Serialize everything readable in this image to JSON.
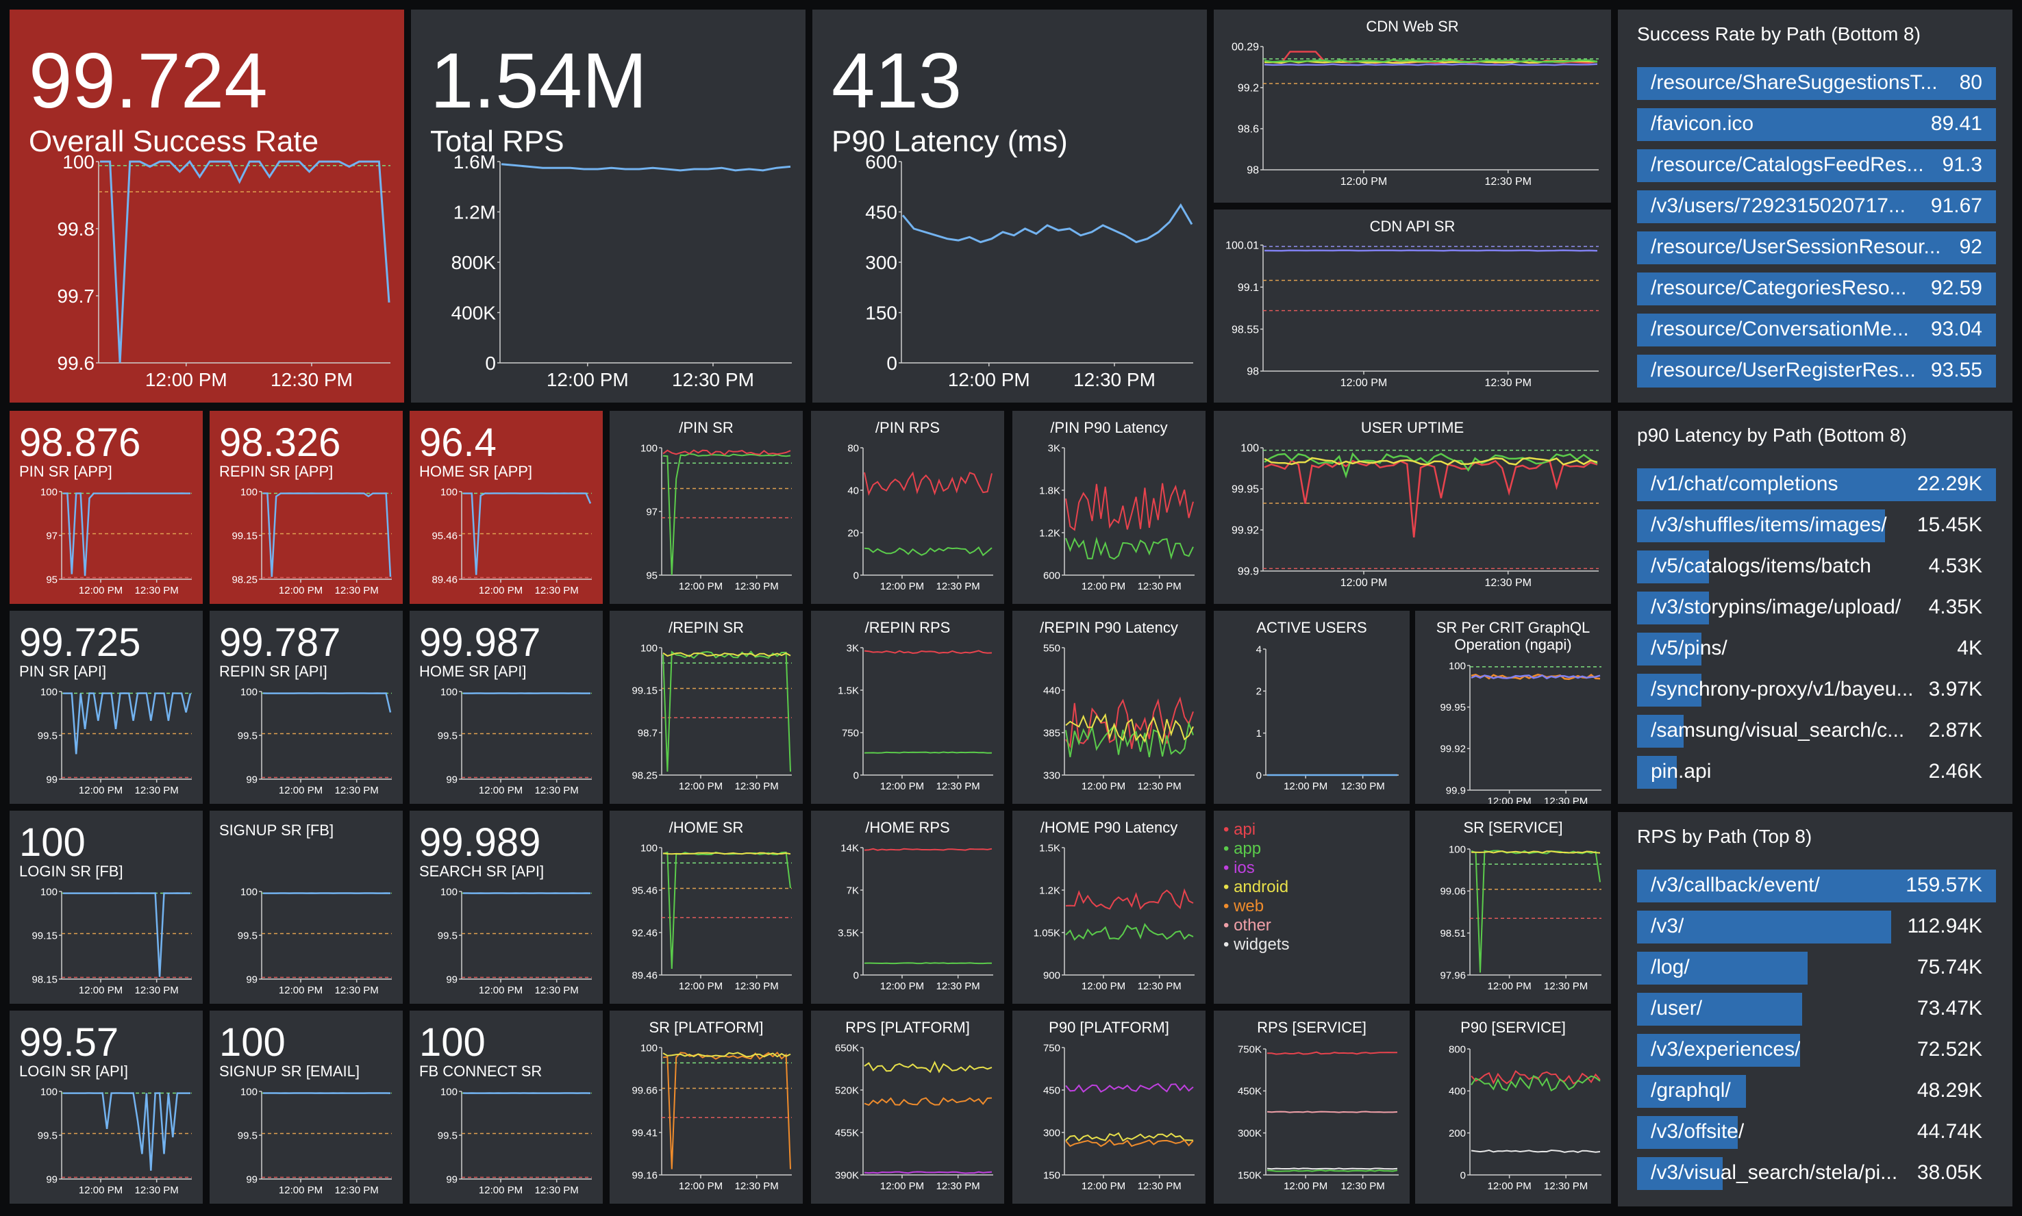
{
  "top_panels": [
    {
      "value": "99.724",
      "label": "Overall Success Rate"
    },
    {
      "value": "1.54M",
      "label": "Total RPS"
    },
    {
      "value": "413",
      "label": "P90 Latency (ms)"
    }
  ],
  "small_stats": [
    {
      "value": "98.876",
      "label": "PIN SR [APP]"
    },
    {
      "value": "98.326",
      "label": "REPIN SR [APP]"
    },
    {
      "value": "96.4",
      "label": "HOME SR [APP]"
    },
    {
      "value": "99.725",
      "label": "PIN SR [API]"
    },
    {
      "value": "99.787",
      "label": "REPIN SR [API]"
    },
    {
      "value": "99.987",
      "label": "HOME SR [API]"
    },
    {
      "value": "100",
      "label": "LOGIN SR [FB]"
    },
    {
      "value": "",
      "label": "SIGNUP SR [FB]"
    },
    {
      "value": "99.989",
      "label": "SEARCH SR [API]"
    },
    {
      "value": "99.57",
      "label": "LOGIN SR [API]"
    },
    {
      "value": "100",
      "label": "SIGNUP SR [EMAIL]"
    },
    {
      "value": "100",
      "label": "FB CONNECT SR"
    }
  ],
  "titled_charts": [
    "CDN Web SR",
    "CDN API SR",
    "/PIN SR",
    "/PIN RPS",
    "/PIN P90 Latency",
    "USER UPTIME",
    "/REPIN SR",
    "/REPIN RPS",
    "/REPIN P90 Latency",
    "ACTIVE USERS",
    "SR Per CRIT GraphQL Operation (ngapi)",
    "/HOME SR",
    "/HOME RPS",
    "/HOME P90 Latency",
    "SR [SERVICE]",
    "SR [PLATFORM]",
    "RPS [PLATFORM]",
    "P90 [PLATFORM]",
    "RPS [SERVICE]",
    "P90 [SERVICE]"
  ],
  "legend": [
    {
      "name": "api",
      "color": "#e8434d"
    },
    {
      "name": "app",
      "color": "#5bcc4b"
    },
    {
      "name": "ios",
      "color": "#c040e0"
    },
    {
      "name": "android",
      "color": "#e8e04a"
    },
    {
      "name": "web",
      "color": "#f08c2c"
    },
    {
      "name": "other",
      "color": "#f0a0a8"
    },
    {
      "name": "widgets",
      "color": "#e8e8e8"
    }
  ],
  "success_rate_by_path": {
    "title": "Success Rate by Path (Bottom 8)",
    "rows": [
      {
        "path": "/resource/ShareSuggestionsT...",
        "value": "80",
        "fill": 1.0
      },
      {
        "path": "/favicon.ico",
        "value": "89.41",
        "fill": 1.0
      },
      {
        "path": "/resource/CatalogsFeedRes...",
        "value": "91.3",
        "fill": 1.0
      },
      {
        "path": "/v3/users/7292315020717...",
        "value": "91.67",
        "fill": 1.0
      },
      {
        "path": "/resource/UserSessionResour...",
        "value": "92",
        "fill": 1.0
      },
      {
        "path": "/resource/CategoriesReso...",
        "value": "92.59",
        "fill": 1.0
      },
      {
        "path": "/resource/ConversationMe...",
        "value": "93.04",
        "fill": 1.0
      },
      {
        "path": "/resource/UserRegisterRes...",
        "value": "93.55",
        "fill": 1.0
      }
    ]
  },
  "p90_by_path": {
    "title": "p90 Latency by Path (Bottom 8)",
    "rows": [
      {
        "path": "/v1/chat/completions",
        "value": "22.29K",
        "fill": 1.0
      },
      {
        "path": "/v3/shuffles/items/images/",
        "value": "15.45K",
        "fill": 0.69
      },
      {
        "path": "/v5/catalogs/items/batch",
        "value": "4.53K",
        "fill": 0.2
      },
      {
        "path": "/v3/storypins/image/upload/",
        "value": "4.35K",
        "fill": 0.2
      },
      {
        "path": "/v5/pins/",
        "value": "4K",
        "fill": 0.18
      },
      {
        "path": "/synchrony-proxy/v1/bayeu...",
        "value": "3.97K",
        "fill": 0.18
      },
      {
        "path": "/samsung/visual_search/c...",
        "value": "2.87K",
        "fill": 0.13
      },
      {
        "path": "pin.api",
        "value": "2.46K",
        "fill": 0.11
      }
    ]
  },
  "rps_by_path": {
    "title": "RPS by Path (Top 8)",
    "rows": [
      {
        "path": "/v3/callback/event/",
        "value": "159.57K",
        "fill": 1.0
      },
      {
        "path": "/v3/",
        "value": "112.94K",
        "fill": 0.708
      },
      {
        "path": "/log/",
        "value": "75.74K",
        "fill": 0.475
      },
      {
        "path": "/user/",
        "value": "73.47K",
        "fill": 0.46
      },
      {
        "path": "/v3/experiences/",
        "value": "72.52K",
        "fill": 0.455
      },
      {
        "path": "/graphql/",
        "value": "48.29K",
        "fill": 0.303
      },
      {
        "path": "/v3/offsite/",
        "value": "44.74K",
        "fill": 0.28
      },
      {
        "path": "/v3/visual_search/stela/pi...",
        "value": "38.05K",
        "fill": 0.238
      }
    ]
  },
  "chart_data": [
    {
      "type": "line",
      "name": "overall_sr",
      "ylim": [
        99.6,
        100
      ],
      "yticks": [
        "100",
        "99.8",
        "99.7",
        "99.6"
      ],
      "xticks": [
        "12:00 PM",
        "12:30 PM"
      ],
      "series": [
        {
          "color": "#73b3f0",
          "values": [
            100,
            100,
            99.6,
            100,
            100,
            99.99,
            100,
            100,
            99.98,
            100,
            99.97,
            100,
            100,
            100,
            99.96,
            100,
            100,
            99.97,
            100,
            100,
            100,
            99.98,
            100,
            100,
            100,
            99.99,
            100,
            100,
            100,
            99.72
          ]
        }
      ]
    },
    {
      "type": "line",
      "name": "total_rps",
      "ylim": [
        0,
        1600000
      ],
      "yticks": [
        "1.6M",
        "1.2M",
        "800K",
        "400K",
        "0"
      ],
      "xticks": [
        "12:00 PM",
        "12:30 PM"
      ],
      "series": [
        {
          "color": "#73b3f0",
          "values": [
            1.58,
            1.57,
            1.56,
            1.55,
            1.55,
            1.55,
            1.54,
            1.54,
            1.55,
            1.54,
            1.54,
            1.55,
            1.54,
            1.53,
            1.54,
            1.54,
            1.55,
            1.53,
            1.54,
            1.53,
            1.55,
            1.56
          ]
        }
      ]
    },
    {
      "type": "line",
      "name": "p90_latency",
      "ylim": [
        0,
        600
      ],
      "yticks": [
        "600",
        "450",
        "300",
        "150",
        "0"
      ],
      "xticks": [
        "12:00 PM",
        "12:30 PM"
      ],
      "series": [
        {
          "color": "#73b3f0",
          "values": [
            440,
            400,
            390,
            380,
            370,
            365,
            375,
            360,
            370,
            390,
            380,
            400,
            385,
            410,
            395,
            400,
            380,
            390,
            410,
            395,
            380,
            360,
            370,
            390,
            420,
            470,
            413
          ]
        }
      ]
    }
  ]
}
